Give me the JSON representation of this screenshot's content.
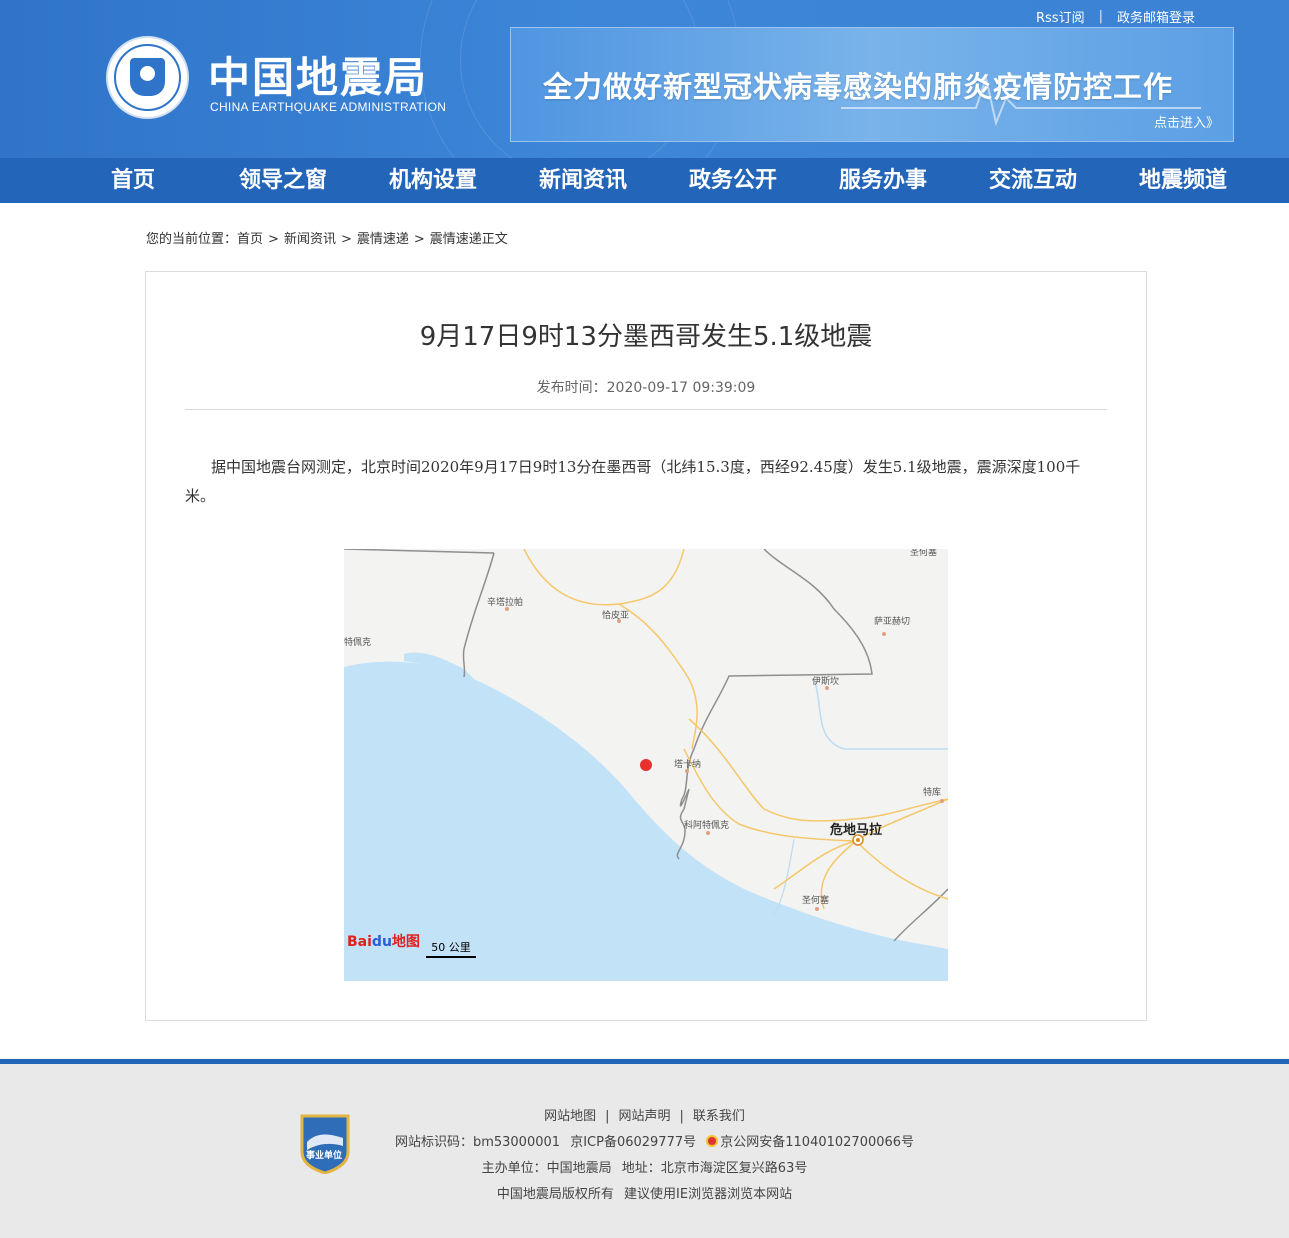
{
  "header": {
    "top_links": {
      "rss": "Rss订阅",
      "mail_login": "政务邮箱登录"
    },
    "site_name": "中国地震局",
    "site_name_en": "CHINA EARTHQUAKE ADMINISTRATION",
    "banner": {
      "headline": "全力做好新型冠状病毒感染的肺炎疫情防控工作",
      "link": "点击进入》"
    }
  },
  "nav": [
    "首页",
    "领导之窗",
    "机构设置",
    "新闻资讯",
    "政务公开",
    "服务办事",
    "交流互动",
    "地震频道"
  ],
  "breadcrumb": {
    "prefix": "您的当前位置：",
    "items": [
      "首页",
      "新闻资讯",
      "震情速递",
      "震情速递正文"
    ],
    "separator": ">"
  },
  "article": {
    "title": "9月17日9时13分墨西哥发生5.1级地震",
    "publish_label": "发布时间：",
    "publish_time": "2020-09-17 09:39:09",
    "body": "据中国地震台网测定，北京时间2020年9月17日9时13分在墨西哥（北纬15.3度，西经92.45度）发生5.1级地震，震源深度100千米。"
  },
  "map": {
    "labels": [
      "辛塔拉帕",
      "恰皮亚",
      "萨亚赫切",
      "伊斯坎",
      "塔卡纳",
      "特库",
      "科阿特佩克",
      "危地马拉",
      "圣何塞",
      "特佩克",
      "圣何塞"
    ],
    "logo_text_1": "Bai",
    "logo_text_2": "du",
    "logo_text_3": "地图",
    "scale": "50 公里",
    "colors": {
      "sea": "#c2e2f8",
      "land": "#f3f3f1",
      "border": "#8e8e8e",
      "road": "#f5c76a",
      "epicenter": "#e8302f"
    }
  },
  "footer": {
    "links": [
      "网站地图",
      "网站声明",
      "联系我们"
    ],
    "site_id": "网站标识码：bm53000001",
    "icp": "京ICP备06029777号",
    "police": "京公网安备11040102700066号",
    "host_label": "主办单位：中国地震局",
    "address": "地址：北京市海淀区复兴路63号",
    "copyright": "中国地震局版权所有",
    "browser_tip": "建议使用IE浏览器浏览本网站",
    "badge_text": "事业单位"
  }
}
